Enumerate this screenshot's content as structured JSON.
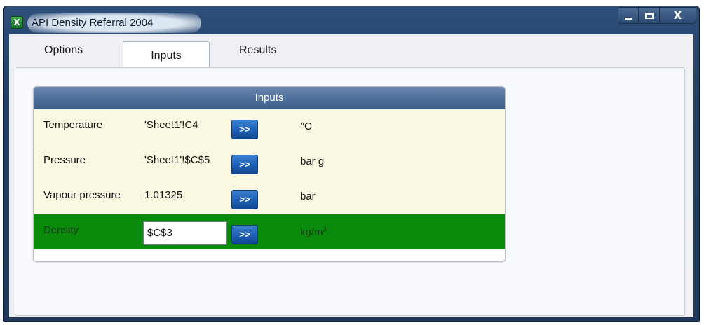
{
  "window": {
    "title": "API Density Referral 2004",
    "app_icon": "X",
    "close_glyph": "X"
  },
  "tabs": [
    {
      "label": "Options",
      "active": false
    },
    {
      "label": "Inputs",
      "active": true
    },
    {
      "label": "Results",
      "active": false
    }
  ],
  "inputs_group": {
    "header": "Inputs",
    "rows": [
      {
        "label": "Temperature",
        "value": "'Sheet1'!C4",
        "button": ">>",
        "unit": "°C"
      },
      {
        "label": "Pressure",
        "value": "'Sheet1'!$C$5",
        "button": ">>",
        "unit": "bar g"
      },
      {
        "label": "Vapour pressure",
        "value": "1.01325",
        "button": ">>",
        "unit": "bar"
      }
    ],
    "density": {
      "label": "Density",
      "value": "$C$3",
      "button": ">>",
      "unit": "kg/m",
      "unit_sup": "3"
    }
  },
  "colors": {
    "title_bar": "#233e63",
    "group_header": "#4e6f9a",
    "row_background": "#fbf8e2",
    "density_row": "#0a8a0a",
    "arrow_button": "#1d5fb3"
  },
  "icons": [
    "excel-icon",
    "minimize-icon",
    "maximize-icon",
    "close-icon",
    "arrow-button-icon"
  ]
}
